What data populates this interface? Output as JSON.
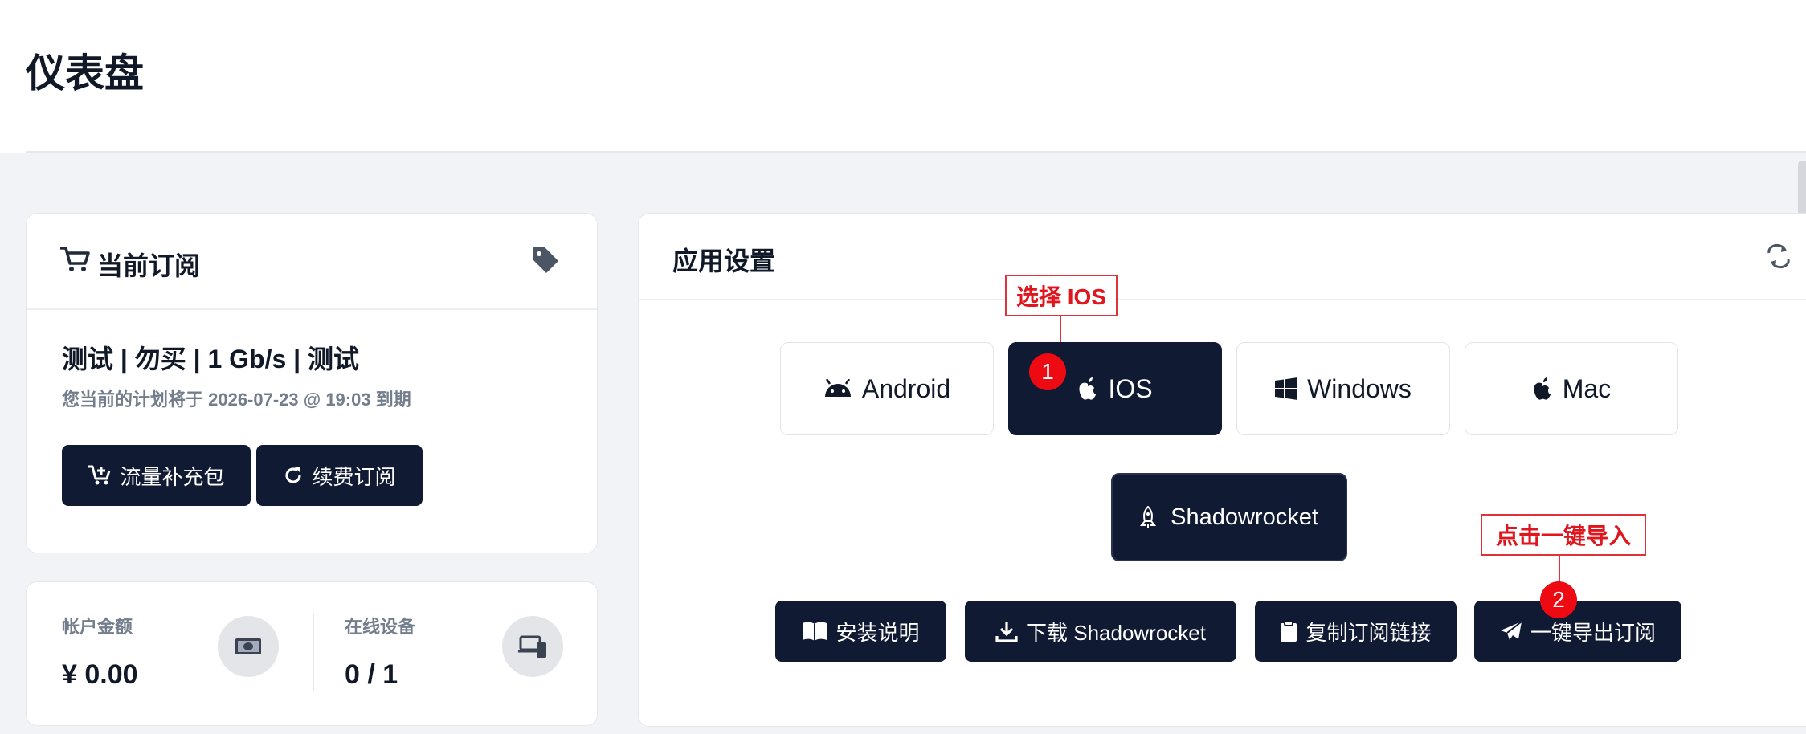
{
  "page": {
    "title": "仪表盘"
  },
  "subscription": {
    "title": "当前订阅",
    "plan_name": "测试 | 勿买 | 1 Gb/s | 测试",
    "expiry_text": "您当前的计划将于 2026-07-23 @ 19:03 到期",
    "traffic_button": "流量补充包",
    "renew_button": "续费订阅"
  },
  "stats": {
    "balance_label": "帐户金额",
    "balance_value": "¥ 0.00",
    "devices_label": "在线设备",
    "devices_value": "0 / 1"
  },
  "app_settings": {
    "title": "应用设置",
    "os_options": [
      "Android",
      "IOS",
      "Windows",
      "Mac"
    ],
    "selected_os": "IOS",
    "client_name": "Shadowrocket",
    "actions": {
      "install_guide": "安装说明",
      "download": "下载 Shadowrocket",
      "copy_link": "复制订阅链接",
      "one_click_import": "一键导出订阅"
    }
  },
  "annotations": {
    "step1_label": "选择 IOS",
    "step1_number": "1",
    "step2_label": "点击一键导入",
    "step2_number": "2"
  },
  "colors": {
    "primary_dark": "#111a33",
    "annotation_red": "#e0161e",
    "muted_text": "#737d8c"
  },
  "icons": {
    "subscription": "cart-icon",
    "tag": "tag-icon",
    "traffic": "cart-plus-icon",
    "renew": "redo-icon",
    "balance": "money-icon",
    "devices": "devices-icon",
    "refresh": "refresh-icon",
    "android": "android-icon",
    "ios": "apple-icon",
    "windows": "windows-icon",
    "mac": "apple-icon",
    "client": "rocket-icon",
    "install_guide": "book-icon",
    "download": "download-icon",
    "copy_link": "clipboard-icon",
    "import": "paper-plane-icon"
  }
}
